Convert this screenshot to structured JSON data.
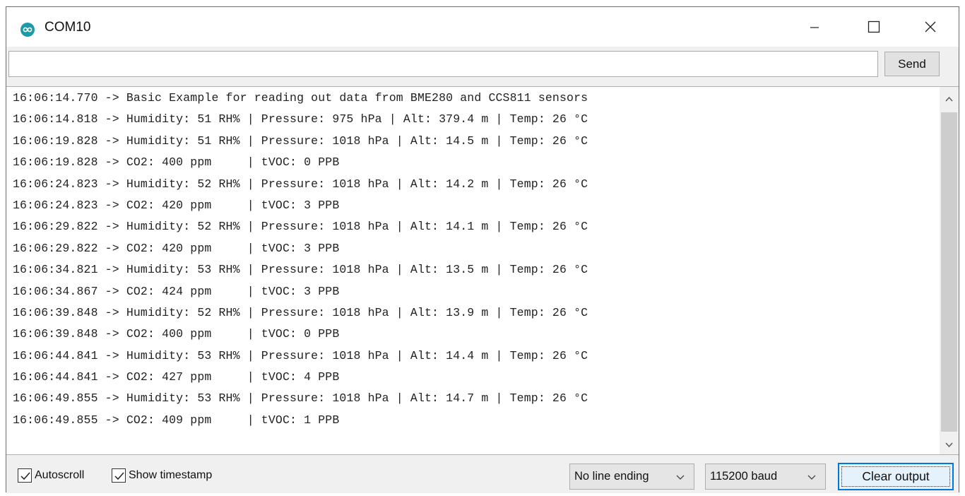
{
  "window": {
    "title": "COM10",
    "app_icon": "arduino-icon",
    "controls": [
      "minimize-icon",
      "maximize-icon",
      "close-icon"
    ]
  },
  "toolbar": {
    "input_value": "",
    "send_label": "Send"
  },
  "output": {
    "lines": [
      "16:06:14.770 -> Basic Example for reading out data from BME280 and CCS811 sensors",
      "16:06:14.818 -> Humidity: 51 RH% | Pressure: 975 hPa | Alt: 379.4 m | Temp: 26 °C",
      "16:06:19.828 -> Humidity: 51 RH% | Pressure: 1018 hPa | Alt: 14.5 m | Temp: 26 °C",
      "16:06:19.828 -> CO2: 400 ppm     | tVOC: 0 PPB",
      "16:06:24.823 -> Humidity: 52 RH% | Pressure: 1018 hPa | Alt: 14.2 m | Temp: 26 °C",
      "16:06:24.823 -> CO2: 420 ppm     | tVOC: 3 PPB",
      "16:06:29.822 -> Humidity: 52 RH% | Pressure: 1018 hPa | Alt: 14.1 m | Temp: 26 °C",
      "16:06:29.822 -> CO2: 420 ppm     | tVOC: 3 PPB",
      "16:06:34.821 -> Humidity: 53 RH% | Pressure: 1018 hPa | Alt: 13.5 m | Temp: 26 °C",
      "16:06:34.867 -> CO2: 424 ppm     | tVOC: 3 PPB",
      "16:06:39.848 -> Humidity: 52 RH% | Pressure: 1018 hPa | Alt: 13.9 m | Temp: 26 °C",
      "16:06:39.848 -> CO2: 400 ppm     | tVOC: 0 PPB",
      "16:06:44.841 -> Humidity: 53 RH% | Pressure: 1018 hPa | Alt: 14.4 m | Temp: 26 °C",
      "16:06:44.841 -> CO2: 427 ppm     | tVOC: 4 PPB",
      "16:06:49.855 -> Humidity: 53 RH% | Pressure: 1018 hPa | Alt: 14.7 m | Temp: 26 °C",
      "16:06:49.855 -> CO2: 409 ppm     | tVOC: 1 PPB"
    ]
  },
  "statusbar": {
    "autoscroll": {
      "label": "Autoscroll",
      "checked": true
    },
    "show_timestamp": {
      "label": "Show timestamp",
      "checked": true
    },
    "line_ending": "No line ending",
    "baud_rate": "115200 baud",
    "clear_label": "Clear output"
  },
  "colors": {
    "app_icon": "#1e9aa6",
    "focus_border": "#0078d7",
    "chrome": "#f0f0f0"
  }
}
